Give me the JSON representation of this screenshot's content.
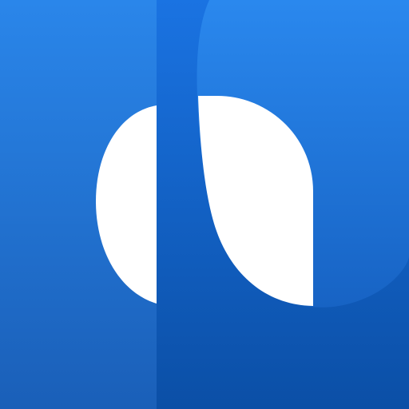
{
  "icon": {
    "name": "app-logo-icon",
    "colors": {
      "background_top": "#2a86ea",
      "background_bottom": "#1a5fb8",
      "panel_top": "#1a73e2",
      "panel_bottom": "#0b4fa6",
      "shape": "#ffffff"
    }
  }
}
